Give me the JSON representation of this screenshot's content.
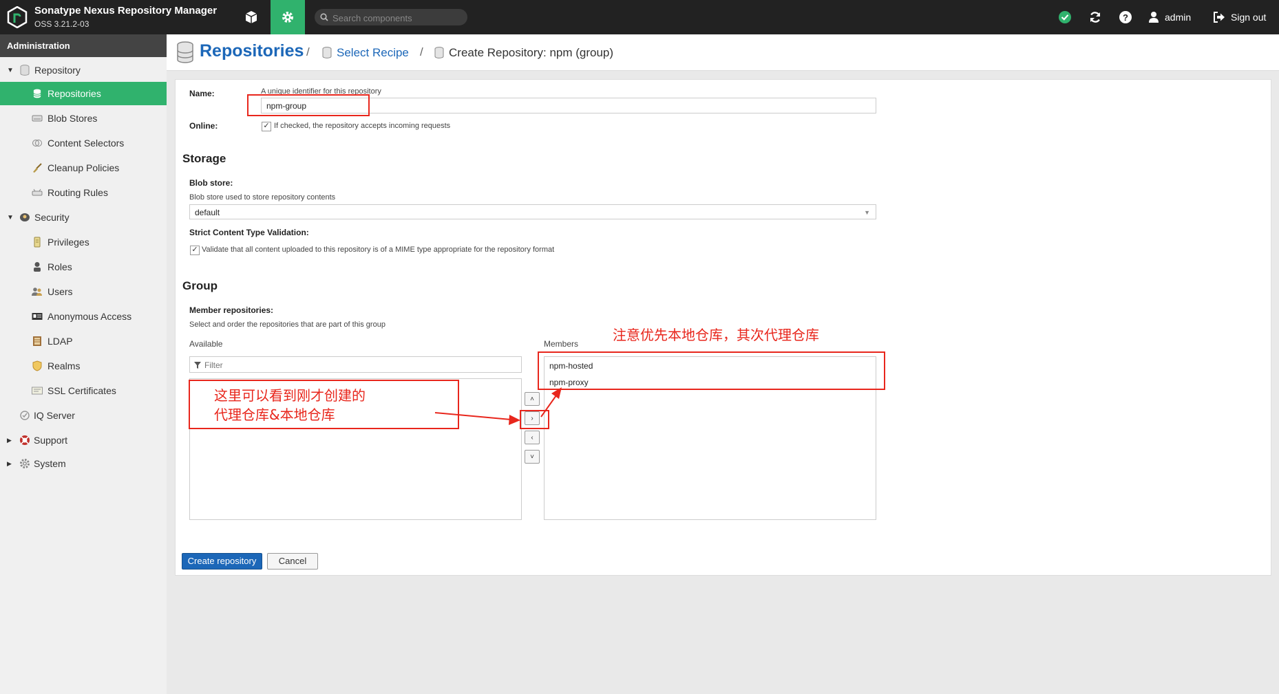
{
  "app": {
    "title": "Sonatype Nexus Repository Manager",
    "version": "OSS 3.21.2-03"
  },
  "topbar": {
    "search_placeholder": "Search components",
    "user": "admin",
    "signout": "Sign out",
    "icons": [
      "browse-cube-icon",
      "admin-gear-icon",
      "search-icon",
      "status-check-icon",
      "refresh-icon",
      "help-icon",
      "user-icon",
      "signout-icon"
    ]
  },
  "sidebar": {
    "header": "Administration",
    "items": [
      {
        "label": "Repository",
        "icon": "database-icon"
      },
      {
        "label": "Repositories",
        "icon": "database-icon"
      },
      {
        "label": "Blob Stores",
        "icon": "hdd-icon"
      },
      {
        "label": "Content Selectors",
        "icon": "layers-icon"
      },
      {
        "label": "Cleanup Policies",
        "icon": "brush-icon"
      },
      {
        "label": "Routing Rules",
        "icon": "router-icon"
      },
      {
        "label": "Security",
        "icon": "shield-icon"
      },
      {
        "label": "Privileges",
        "icon": "badge-icon"
      },
      {
        "label": "Roles",
        "icon": "role-icon"
      },
      {
        "label": "Users",
        "icon": "users-icon"
      },
      {
        "label": "Anonymous Access",
        "icon": "id-card-icon"
      },
      {
        "label": "LDAP",
        "icon": "book-icon"
      },
      {
        "label": "Realms",
        "icon": "realm-shield-icon"
      },
      {
        "label": "SSL Certificates",
        "icon": "certificate-icon"
      },
      {
        "label": "IQ Server",
        "icon": "iq-icon"
      },
      {
        "label": "Support",
        "icon": "support-icon"
      },
      {
        "label": "System",
        "icon": "system-gear-icon"
      }
    ]
  },
  "breadcrumb": {
    "title": "Repositories",
    "link": "Select Recipe",
    "current": "Create Repository: npm (group)",
    "separator": "/"
  },
  "form": {
    "name_label": "Name:",
    "name_help": "A unique identifier for this repository",
    "name_value": "npm-group",
    "online_label": "Online:",
    "online_help": "If checked, the repository accepts incoming requests",
    "storage_title": "Storage",
    "blob_label": "Blob store:",
    "blob_help": "Blob store used to store repository contents",
    "blob_value": "default",
    "strict_label": "Strict Content Type Validation:",
    "strict_help": "Validate that all content uploaded to this repository is of a MIME type appropriate for the repository format",
    "group_title": "Group",
    "member_label": "Member repositories:",
    "member_help": "Select and order the repositories that are part of this group",
    "available_label": "Available",
    "filter_placeholder": "Filter",
    "members_label": "Members",
    "members": [
      "npm-hosted",
      "npm-proxy"
    ],
    "move_buttons": [
      "˄",
      "›",
      "‹",
      "˅"
    ],
    "create_button": "Create repository",
    "cancel_button": "Cancel"
  },
  "annotations": {
    "available_note_line1": "这里可以看到刚才创建的",
    "available_note_line2": "代理仓库&本地仓库",
    "members_note": "注意优先本地仓库，其次代理仓库",
    "color": "#e8261c"
  }
}
